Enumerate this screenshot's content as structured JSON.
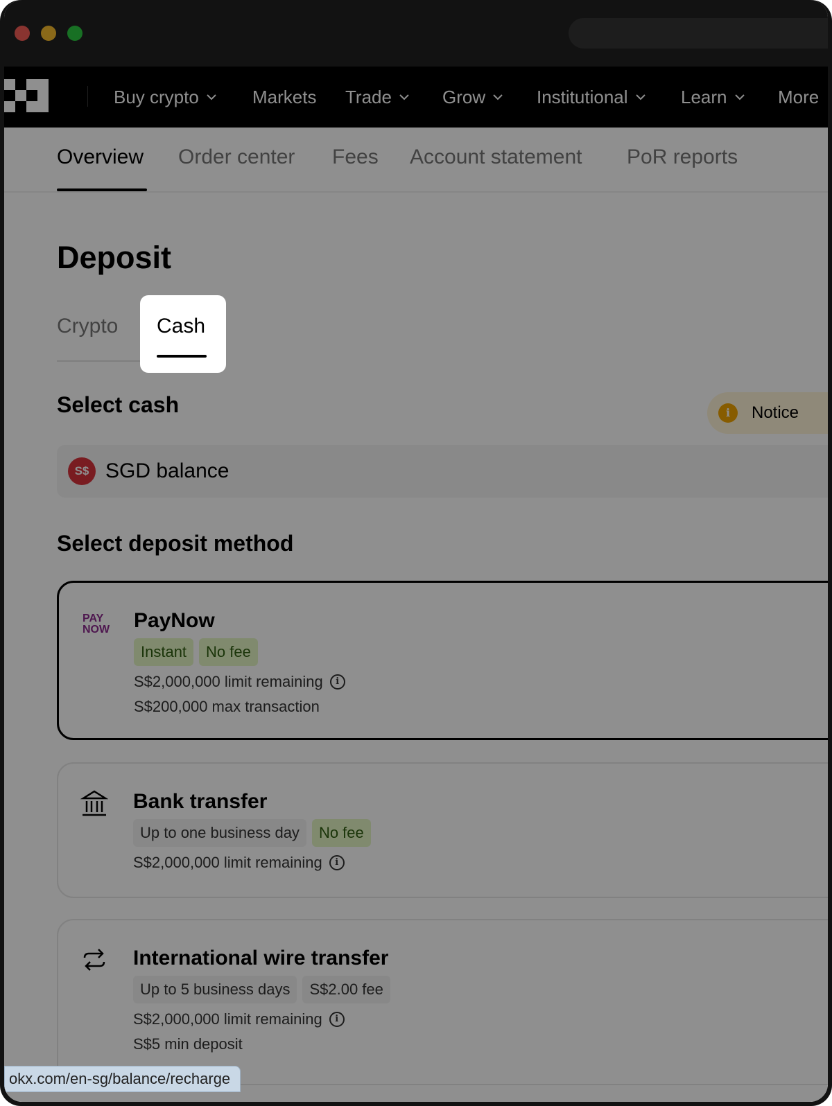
{
  "topnav": {
    "items": [
      {
        "label": "Buy crypto",
        "dropdown": true
      },
      {
        "label": "Markets",
        "dropdown": false
      },
      {
        "label": "Trade",
        "dropdown": true
      },
      {
        "label": "Grow",
        "dropdown": true
      },
      {
        "label": "Institutional",
        "dropdown": true
      },
      {
        "label": "Learn",
        "dropdown": true
      },
      {
        "label": "More",
        "dropdown": false
      }
    ]
  },
  "subtabs": {
    "overview": "Overview",
    "order_center": "Order center",
    "fees": "Fees",
    "account_statement": "Account statement",
    "por_reports": "PoR reports"
  },
  "deposit": {
    "title": "Deposit",
    "tabs": {
      "crypto": "Crypto",
      "cash": "Cash"
    },
    "select_cash_label": "Select cash",
    "notice": "Notice",
    "selected_currency": "SGD balance",
    "currency_icon_text": "S$",
    "select_method_label": "Select deposit method"
  },
  "methods": [
    {
      "icon": "paynow-icon",
      "title": "PayNow",
      "tags": [
        {
          "text": "Instant",
          "tone": "green"
        },
        {
          "text": "No fee",
          "tone": "green"
        }
      ],
      "lines": [
        "S$2,000,000 limit remaining",
        "S$200,000 max transaction"
      ],
      "selected": true
    },
    {
      "icon": "bank-icon",
      "title": "Bank transfer",
      "tags": [
        {
          "text": "Up to one business day",
          "tone": "grey"
        },
        {
          "text": "No fee",
          "tone": "green"
        }
      ],
      "lines": [
        "S$2,000,000 limit remaining"
      ],
      "selected": false
    },
    {
      "icon": "transfer-arrows-icon",
      "title": "International wire transfer",
      "tags": [
        {
          "text": "Up to 5 business days",
          "tone": "grey"
        },
        {
          "text": "S$2.00 fee",
          "tone": "grey"
        }
      ],
      "lines": [
        "S$2,000,000 limit remaining",
        "S$5 min deposit"
      ],
      "selected": false
    }
  ],
  "paynow_logo": {
    "top": "PAY",
    "bottom": "NOW"
  },
  "status_url": "okx.com/en-sg/balance/recharge",
  "colors": {
    "accent_green_bg": "#e5f7c4",
    "notice_bg": "#fff4d8",
    "sgd_red": "#d8333c"
  }
}
